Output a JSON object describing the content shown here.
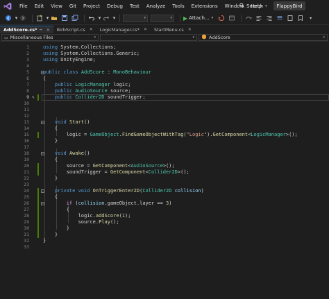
{
  "menu": {
    "items": [
      "File",
      "Edit",
      "View",
      "Git",
      "Project",
      "Debug",
      "Test",
      "Analyze",
      "Tools",
      "Extensions",
      "Window",
      "Help"
    ],
    "search_label": "Search",
    "solution_name": "FlappyBird"
  },
  "toolbar": {
    "attach_label": "Attach..."
  },
  "tabs": [
    {
      "label": "AddScore.cs*",
      "active": true
    },
    {
      "label": "BirbScript.cs",
      "active": false
    },
    {
      "label": "LogicManager.cs*",
      "active": false
    },
    {
      "label": "StartMenu.cs",
      "active": false
    }
  ],
  "navbar": {
    "project": "Miscellaneous Files",
    "member": "AddScore"
  },
  "editor": {
    "current_line": 9,
    "lines": [
      {
        "n": "1",
        "tokens": [
          [
            "kw",
            "using"
          ],
          [
            "tx",
            " System.Collections;"
          ]
        ]
      },
      {
        "n": "2",
        "tokens": [
          [
            "kw",
            "using"
          ],
          [
            "tx",
            " System.Collections.Generic;"
          ]
        ]
      },
      {
        "n": "3",
        "tokens": [
          [
            "kw",
            "using"
          ],
          [
            "tx",
            " UnityEngine;"
          ]
        ]
      },
      {
        "n": "4",
        "tokens": []
      },
      {
        "n": "5",
        "tokens": [
          [
            "kw",
            "public"
          ],
          [
            "tx",
            " "
          ],
          [
            "kw",
            "class"
          ],
          [
            "tx",
            " "
          ],
          [
            "ty",
            "AddScore"
          ],
          [
            "tx",
            " : "
          ],
          [
            "ty",
            "MonoBehaviour"
          ]
        ]
      },
      {
        "n": "6",
        "tokens": [
          [
            "tx",
            "{"
          ]
        ]
      },
      {
        "n": "7",
        "tokens": [
          [
            "tx",
            "    "
          ],
          [
            "kw",
            "public"
          ],
          [
            "tx",
            " "
          ],
          [
            "ty",
            "LogicManager"
          ],
          [
            "tx",
            " logic;"
          ]
        ]
      },
      {
        "n": "8",
        "tokens": [
          [
            "tx",
            "    "
          ],
          [
            "kw",
            "public"
          ],
          [
            "tx",
            " "
          ],
          [
            "ty",
            "AudioSource"
          ],
          [
            "tx",
            " source;"
          ]
        ]
      },
      {
        "n": "9",
        "tokens": [
          [
            "tx",
            "    "
          ],
          [
            "kw",
            "public"
          ],
          [
            "tx",
            " "
          ],
          [
            "ty",
            "Collider2D"
          ],
          [
            "tx",
            " soundTrigger;"
          ]
        ]
      },
      {
        "n": "10",
        "tokens": []
      },
      {
        "n": "11",
        "tokens": []
      },
      {
        "n": "12",
        "tokens": []
      },
      {
        "n": "13",
        "tokens": [
          [
            "tx",
            "    "
          ],
          [
            "kw",
            "void"
          ],
          [
            "tx",
            " "
          ],
          [
            "fn",
            "Start"
          ],
          [
            "tx",
            "()"
          ]
        ]
      },
      {
        "n": "14",
        "tokens": [
          [
            "tx",
            "    {"
          ]
        ]
      },
      {
        "n": "15",
        "tokens": [
          [
            "tx",
            "        logic = "
          ],
          [
            "ty",
            "GameObject"
          ],
          [
            "tx",
            "."
          ],
          [
            "fn",
            "FindGameObjectWithTag"
          ],
          [
            "tx",
            "("
          ],
          [
            "st",
            "\"Logic\""
          ],
          [
            "tx",
            ")."
          ],
          [
            "fn",
            "GetComponent"
          ],
          [
            "tx",
            "<"
          ],
          [
            "ty",
            "LogicManager"
          ],
          [
            "tx",
            ">();"
          ]
        ]
      },
      {
        "n": "16",
        "tokens": [
          [
            "tx",
            "    }"
          ]
        ]
      },
      {
        "n": "17",
        "tokens": []
      },
      {
        "n": "18",
        "tokens": [
          [
            "tx",
            "    "
          ],
          [
            "kw",
            "void"
          ],
          [
            "tx",
            " "
          ],
          [
            "fn",
            "Awake"
          ],
          [
            "tx",
            "()"
          ]
        ]
      },
      {
        "n": "19",
        "tokens": [
          [
            "tx",
            "    {"
          ]
        ]
      },
      {
        "n": "20",
        "tokens": [
          [
            "tx",
            "        source = "
          ],
          [
            "fn",
            "GetComponent"
          ],
          [
            "tx",
            "<"
          ],
          [
            "ty",
            "AudioSource"
          ],
          [
            "tx",
            ">();"
          ]
        ]
      },
      {
        "n": "21",
        "tokens": [
          [
            "tx",
            "        soundTrigger = "
          ],
          [
            "fn",
            "GetComponent"
          ],
          [
            "tx",
            "<"
          ],
          [
            "ty",
            "Collider2D"
          ],
          [
            "tx",
            ">();"
          ]
        ]
      },
      {
        "n": "22",
        "tokens": [
          [
            "tx",
            "    }"
          ]
        ]
      },
      {
        "n": "23",
        "tokens": []
      },
      {
        "n": "24",
        "tokens": [
          [
            "tx",
            "    "
          ],
          [
            "kw",
            "private"
          ],
          [
            "tx",
            " "
          ],
          [
            "kw",
            "void"
          ],
          [
            "tx",
            " "
          ],
          [
            "fn",
            "OnTriggerEnter2D"
          ],
          [
            "tx",
            "("
          ],
          [
            "ty",
            "Collider2D"
          ],
          [
            "tx",
            " "
          ],
          [
            "va",
            "collision"
          ],
          [
            "tx",
            ")"
          ]
        ]
      },
      {
        "n": "25",
        "tokens": [
          [
            "tx",
            "    {"
          ]
        ]
      },
      {
        "n": "26",
        "tokens": [
          [
            "tx",
            "        "
          ],
          [
            "ctrl",
            "if"
          ],
          [
            "tx",
            " ("
          ],
          [
            "va",
            "collision"
          ],
          [
            "tx",
            ".gameObject.layer == "
          ],
          [
            "nu",
            "3"
          ],
          [
            "tx",
            ")"
          ]
        ]
      },
      {
        "n": "27",
        "tokens": [
          [
            "tx",
            "        {"
          ]
        ]
      },
      {
        "n": "28",
        "tokens": [
          [
            "tx",
            "            logic."
          ],
          [
            "fn",
            "addScore"
          ],
          [
            "tx",
            "("
          ],
          [
            "nu",
            "1"
          ],
          [
            "tx",
            ");"
          ]
        ]
      },
      {
        "n": "29",
        "tokens": [
          [
            "tx",
            "            source."
          ],
          [
            "fn",
            "Play"
          ],
          [
            "tx",
            "();"
          ]
        ]
      },
      {
        "n": "30",
        "tokens": [
          [
            "tx",
            "        }"
          ]
        ]
      },
      {
        "n": "31",
        "tokens": [
          [
            "tx",
            "    }"
          ]
        ]
      },
      {
        "n": "32",
        "tokens": [
          [
            "tx",
            "}"
          ]
        ]
      },
      {
        "n": "33",
        "tokens": []
      }
    ],
    "changed_lines": [
      9,
      15,
      20,
      21,
      24,
      25,
      26,
      27,
      28,
      29,
      30,
      31
    ],
    "fold_lines": [
      5,
      13,
      18,
      24,
      26
    ]
  }
}
